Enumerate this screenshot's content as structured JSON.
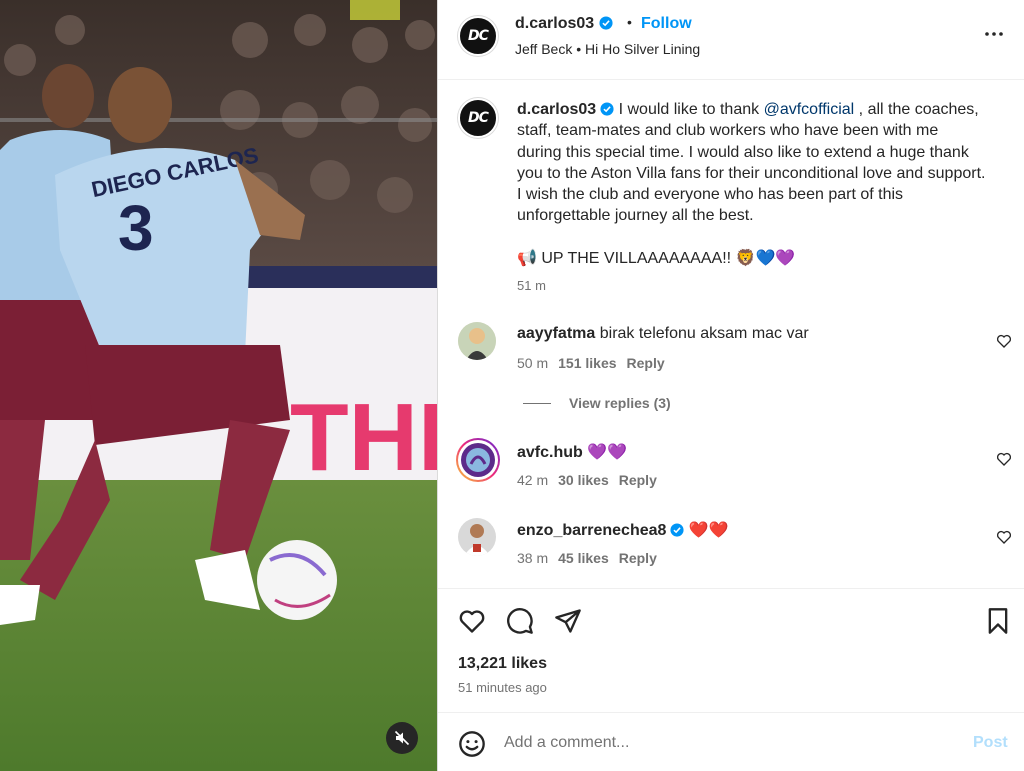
{
  "post": {
    "username": "d.carlos03",
    "follow_label": "Follow",
    "separator": "•",
    "audio": "Jeff Beck • Hi Ho Silver Lining",
    "avatar_initials": "DC",
    "caption_before": " I would like to thank ",
    "mention": "@avfcofficial",
    "caption_after": " , all the coaches, staff, team-mates and club workers who have been with me during this special time. I would also like to extend a huge thank you to the Aston Villa fans for their unconditional love and support. I wish the club and everyone who has been part of this unforgettable journey all the best.",
    "cheer": "📢 UP THE VILLAAAAAAAA!! 🦁💙💜",
    "caption_time": "51 m",
    "likes_total": "13,221 likes",
    "posted_ago": "51 minutes ago"
  },
  "comments": [
    {
      "username": "aayyfatma",
      "text": "birak telefonu aksam mac var",
      "time": "50 m",
      "likes": "151 likes",
      "reply": "Reply",
      "verified": false
    },
    {
      "username": "avfc.hub",
      "text": "💜💜",
      "time": "42 m",
      "likes": "30 likes",
      "reply": "Reply",
      "verified": false
    },
    {
      "username": "enzo_barrenechea8",
      "text": "❤️❤️",
      "time": "38 m",
      "likes": "45 likes",
      "reply": "Reply",
      "verified": true
    }
  ],
  "view_replies": "View replies (3)",
  "comment_bar": {
    "placeholder": "Add a comment...",
    "post_label": "Post"
  },
  "media": {
    "jersey_name": "DIEGO CARLOS",
    "jersey_number": "3",
    "banner_text": "THE UNI"
  },
  "colors": {
    "follow_blue": "#0095f6",
    "verified_blue": "#0095f6",
    "post_disabled": "#b2dffc",
    "jersey_blue": "#9bc4e8",
    "jersey_claret": "#7b1f35"
  },
  "icons": [
    "more-options-icon",
    "verified-badge-icon",
    "heart-icon",
    "comment-icon",
    "share-icon",
    "bookmark-icon",
    "emoji-icon",
    "mute-icon"
  ]
}
